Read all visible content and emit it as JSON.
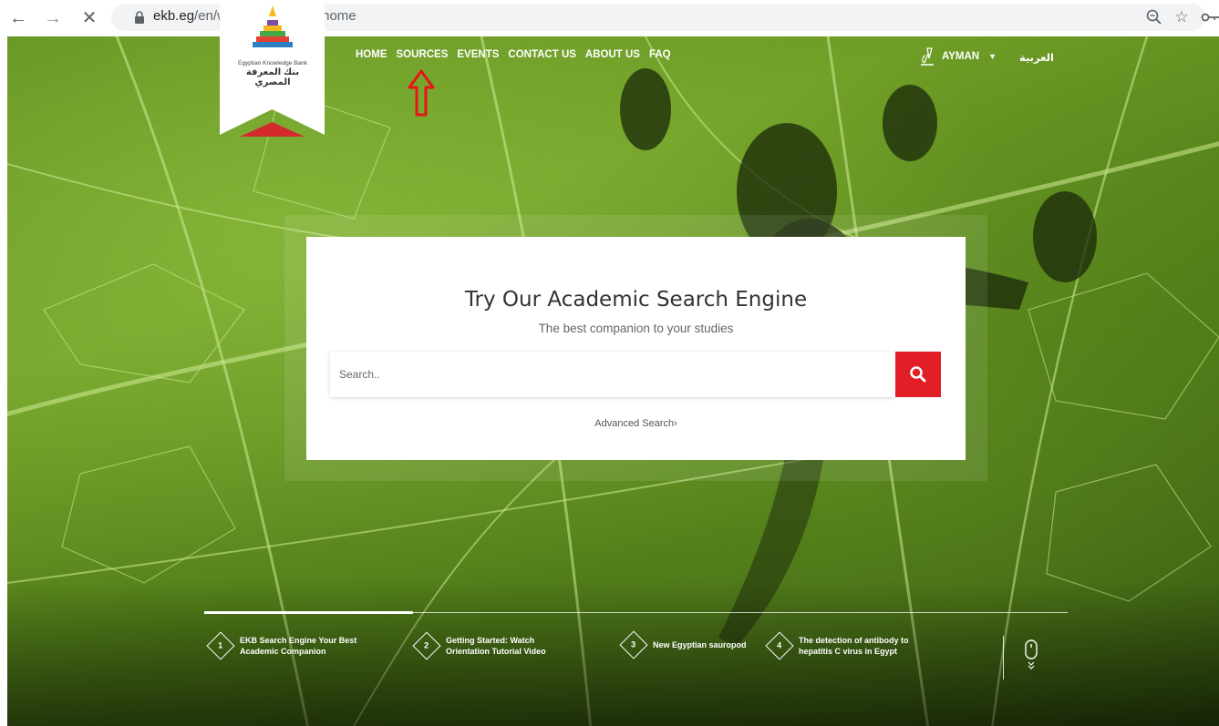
{
  "browser": {
    "url_domain": "ekb.eg",
    "url_path": "/en/web/researchers/home",
    "icons": [
      "back-arrow-icon",
      "forward-arrow-icon",
      "stop-loading-icon",
      "lock-icon",
      "zoom-icon",
      "bookmark-star-icon",
      "key-icon"
    ]
  },
  "logo": {
    "name_en": "Egyptian Knowledge Bank",
    "name_ar": "بنك المعرفة المصري"
  },
  "nav": {
    "items": [
      "HOME",
      "SOURCES",
      "EVENTS",
      "CONTACT US",
      "ABOUT US",
      "FAQ"
    ],
    "user": "AYMAN",
    "language": "العربية"
  },
  "search": {
    "title": "Try Our Academic Search Engine",
    "subtitle": "The best companion to your studies",
    "placeholder": "Search..",
    "advanced": "Advanced Search›"
  },
  "slides": [
    {
      "num": "1",
      "text": "EKB Search Engine Your Best\nAcademic Companion"
    },
    {
      "num": "2",
      "text": "Getting Started: Watch\nOrientation Tutorial Video"
    },
    {
      "num": "3",
      "text": "New Egyptian sauropod"
    },
    {
      "num": "4",
      "text": "The detection of antibody to\nhepatitis C virus in Egypt"
    }
  ],
  "colors": {
    "accent_red": "#e21f26",
    "annotation_red": "#e8141b"
  }
}
